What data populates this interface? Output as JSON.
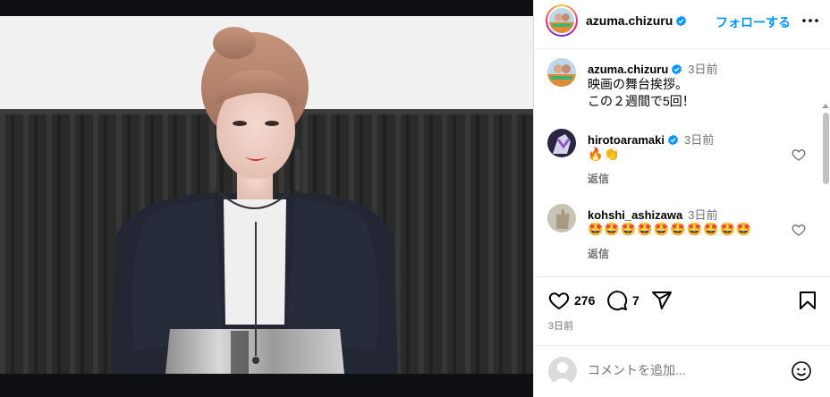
{
  "post": {
    "username": "azuma.chizuru",
    "follow_label": "フォローする"
  },
  "caption": {
    "username": "azuma.chizuru",
    "time": "3日前",
    "text": "映画の舞台挨拶。\nこの２週間で5回！"
  },
  "comments": [
    {
      "username": "hirotoaramaki",
      "time": "3日前",
      "text": "🔥👏",
      "reply_label": "返信"
    },
    {
      "username": "kohshi_ashizawa",
      "time": "3日前",
      "text": "🤩🤩🤩🤩🤩🤩🤩🤩🤩🤩",
      "reply_label": "返信"
    }
  ],
  "actions": {
    "likes": "276",
    "comments": "7",
    "post_time": "3日前"
  },
  "add_comment": {
    "placeholder": "コメントを追加..."
  },
  "icons": {
    "verified": "verified-badge-icon",
    "more": "more-options-icon",
    "like": "heart-icon",
    "comment": "comment-icon",
    "share": "share-icon",
    "save": "bookmark-icon",
    "emoji": "emoji-smile-icon"
  },
  "colors": {
    "accent": "#0095f6",
    "muted": "#737373",
    "photo_bg": "#0e1014"
  }
}
